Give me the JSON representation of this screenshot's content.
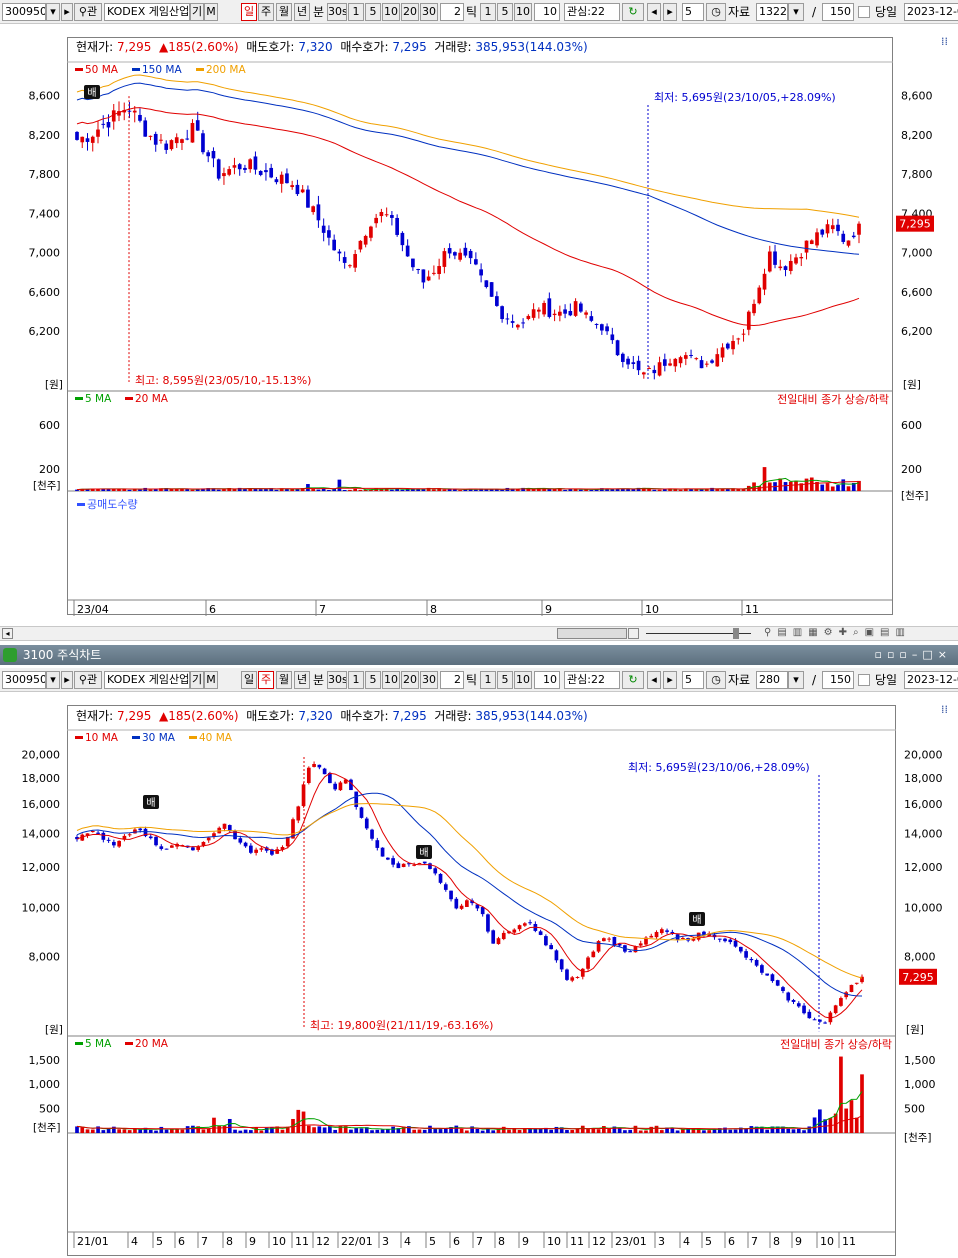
{
  "top": {
    "toolbar": {
      "code": "300950",
      "name": "KODEX 게임산업",
      "gi": "기",
      "m": "M",
      "periods": [
        "일",
        "주",
        "월",
        "년"
      ],
      "unit": "분",
      "sec": "30s",
      "mins": [
        "1",
        "5",
        "10",
        "20",
        "30"
      ],
      "tick_val": "2",
      "tick": "틱",
      "ticks": [
        "1",
        "5",
        "10"
      ],
      "tick10": "10",
      "gwansim": "관심:22",
      "num5": "5",
      "jaryo": "자료",
      "count": "1322",
      "slash": "/",
      "total": "150",
      "dangil": "당일",
      "date": "2023-12-0",
      "selected_period": "일"
    },
    "info": {
      "cur_label": "현재가:",
      "cur": "7,295",
      "chg": "▲185(2.60%)",
      "ask_label": "매도호가:",
      "ask": "7,320",
      "bid_label": "매수호가:",
      "bid": "7,295",
      "vol_label": "거래량:",
      "vol": "385,953(144.03%)"
    },
    "ma_legend": [
      {
        "label": "50 MA",
        "color": "#e00000"
      },
      {
        "label": "150 MA",
        "color": "#0030c0"
      },
      {
        "label": "200 MA",
        "color": "#f0a000"
      }
    ],
    "price_axis": [
      "8,600",
      "8,200",
      "7,800",
      "7,400",
      "7,000",
      "6,600",
      "6,200"
    ],
    "price_unit": "[원]",
    "cur_tag": "7,295",
    "low_note": "최저: 5,695원(23/10/05,+28.09%)",
    "high_note": "최고: 8,595원(23/05/10,-15.13%)",
    "marker": "배",
    "vol_legend": [
      {
        "label": "5 MA",
        "color": "#00a000"
      },
      {
        "label": "20 MA",
        "color": "#e00000"
      }
    ],
    "vol_note": "전일대비 종가 상승/하락",
    "vol_axis": [
      "600",
      "200"
    ],
    "vol_unit": "[천주]",
    "short_legend": "공매도수량",
    "x_axis": [
      "23/04",
      "6",
      "7",
      "8",
      "9",
      "10",
      "11"
    ]
  },
  "window_title": "3100 주식차트",
  "bottom": {
    "toolbar": {
      "code": "300950",
      "name": "KODEX 게임산업",
      "gi": "기",
      "m": "M",
      "periods": [
        "일",
        "주",
        "월",
        "년"
      ],
      "unit": "분",
      "sec": "30s",
      "mins": [
        "1",
        "5",
        "10",
        "20",
        "30"
      ],
      "tick_val": "2",
      "tick": "틱",
      "ticks": [
        "1",
        "5",
        "10"
      ],
      "tick10": "10",
      "gwansim": "관심:22",
      "num5": "5",
      "jaryo": "자료",
      "count": "280",
      "slash": "/",
      "total": "150",
      "dangil": "당일",
      "date": "2023-12-0",
      "selected_period": "주"
    },
    "info": {
      "cur_label": "현재가:",
      "cur": "7,295",
      "chg": "▲185(2.60%)",
      "ask_label": "매도호가:",
      "ask": "7,320",
      "bid_label": "매수호가:",
      "bid": "7,295",
      "vol_label": "거래량:",
      "vol": "385,953(144.03%)"
    },
    "ma_legend": [
      {
        "label": "10 MA",
        "color": "#e00000"
      },
      {
        "label": "30 MA",
        "color": "#0030c0"
      },
      {
        "label": "40 MA",
        "color": "#f0a000"
      }
    ],
    "price_axis": [
      "20,000",
      "18,000",
      "16,000",
      "14,000",
      "12,000",
      "10,000",
      "8,000"
    ],
    "price_unit": "[원]",
    "cur_tag": "7,295",
    "low_note": "최저: 5,695원(23/10/06,+28.09%)",
    "high_note": "최고: 19,800원(21/11/19,-63.16%)",
    "marker": "배",
    "vol_legend": [
      {
        "label": "5 MA",
        "color": "#00a000"
      },
      {
        "label": "20 MA",
        "color": "#e00000"
      }
    ],
    "vol_note": "전일대비 종가 상승/하락",
    "vol_axis": [
      "1,500",
      "1,000",
      "500"
    ],
    "vol_unit": "[천주]",
    "x_axis": [
      "21/01",
      "4",
      "5",
      "6",
      "7",
      "8",
      "9",
      "10",
      "11",
      "12",
      "22/01",
      "3",
      "4",
      "5",
      "6",
      "7",
      "8",
      "9",
      "10",
      "11",
      "12",
      "23/01",
      "3",
      "4",
      "5",
      "6",
      "7",
      "8",
      "9",
      "10",
      "11"
    ]
  },
  "colors": {
    "up": "#e00000",
    "down": "#0000d0",
    "ma_a": "#e00000",
    "ma_b": "#0030c0",
    "ma_c": "#f0a000",
    "vol_ma5": "#00a000",
    "tag": "#e00000"
  },
  "chart_data": [
    {
      "type": "candlestick",
      "period": "daily",
      "y_axis_ticks": [
        8600,
        8200,
        7800,
        7400,
        7000,
        6600,
        6200
      ],
      "ylim": [
        5600,
        8800
      ],
      "close_path": [
        8150,
        8200,
        8300,
        8400,
        8500,
        8300,
        8150,
        8100,
        8200,
        8250,
        8050,
        7800,
        7850,
        7900,
        7850,
        7800,
        7750,
        7700,
        7500,
        7300,
        7050,
        6850,
        7100,
        7350,
        7400,
        7200,
        6900,
        6700,
        6850,
        7050,
        6950,
        6850,
        6600,
        6400,
        6300,
        6300,
        6450,
        6400,
        6380,
        6450,
        6300,
        6250,
        6000,
        5900,
        5750,
        5800,
        5900,
        6000,
        5900,
        5850,
        6000,
        6100,
        6200,
        6600,
        7000,
        6850,
        6950,
        7100,
        7200,
        7250,
        7110,
        7295
      ],
      "current": 7295,
      "high": {
        "value": 8595,
        "date": "23/05/10"
      },
      "low": {
        "value": 5695,
        "date": "23/10/05"
      },
      "volume_axis_ticks": [
        600,
        200
      ]
    },
    {
      "type": "candlestick",
      "period": "weekly",
      "y_axis_ticks": [
        20000,
        18000,
        16000,
        14000,
        12000,
        10000,
        8000
      ],
      "ylim": [
        5600,
        21000
      ],
      "close_path": [
        13500,
        14200,
        13800,
        13200,
        13800,
        14400,
        13600,
        13000,
        13400,
        13000,
        13200,
        14000,
        14600,
        13600,
        12900,
        13000,
        12800,
        13400,
        15800,
        19200,
        18600,
        17200,
        17800,
        15200,
        13800,
        12500,
        12000,
        12200,
        12300,
        11800,
        10800,
        9800,
        10400,
        9700,
        8400,
        9000,
        9200,
        9300,
        8600,
        8000,
        7200,
        7400,
        8200,
        8800,
        8400,
        8100,
        8500,
        8900,
        9000,
        8600,
        8700,
        8900,
        8800,
        8600,
        8200,
        7800,
        7400,
        7000,
        6600,
        6300,
        6000,
        5900,
        6500,
        7000,
        7295
      ],
      "current": 7295,
      "high": {
        "value": 19800,
        "date": "21/11/19"
      },
      "low": {
        "value": 5695,
        "date": "23/10/06"
      },
      "volume_axis_ticks": [
        1500,
        1000,
        500
      ]
    }
  ]
}
